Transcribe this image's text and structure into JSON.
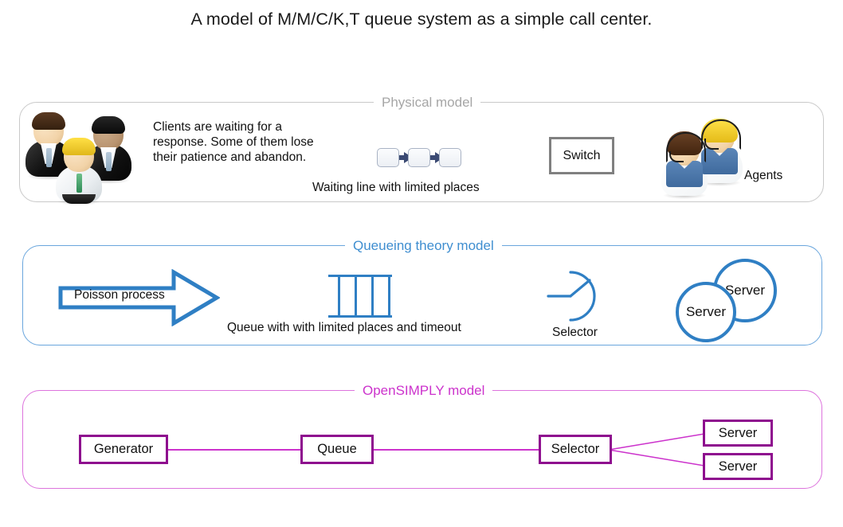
{
  "title": "A model of M/M/C/K,T queue system as a simple call center.",
  "colors": {
    "physical_border": "#c9c9c9",
    "physical_legend": "#a6a6a6",
    "queueing_border": "#6aa6dd",
    "queueing_legend": "#3f8ed0",
    "queueing_accent": "#2f7fc4",
    "opensimply_border": "#dd74dd",
    "opensimply_legend": "#cc33cc",
    "opensimply_box": "#8e0d8e",
    "switch_border": "#808080",
    "waiting_arrow": "#3b4a73"
  },
  "panels": {
    "physical": {
      "legend": "Physical model",
      "clients_text": "Clients are waiting for a response. Some of them lose their patience and abandon.",
      "waiting_caption": "Waiting line with limited places",
      "switch_label": "Switch",
      "agents_label": "Agents",
      "waiting_boxes": [
        "place-1",
        "place-2",
        "place-3"
      ],
      "client_avatars": [
        "client-dark-haired",
        "client-blond",
        "client-dark-skinned"
      ],
      "agent_avatars": [
        "agent-brunette",
        "agent-blonde"
      ]
    },
    "queueing": {
      "legend": "Queueing theory model",
      "poisson_label": "Poisson process",
      "queue_caption": "Queue with with limited places and timeout",
      "selector_label": "Selector",
      "servers": [
        "Server",
        "Server"
      ]
    },
    "opensimply": {
      "legend": "OpenSIMPLY model",
      "nodes": [
        {
          "label": "Generator"
        },
        {
          "label": "Queue"
        },
        {
          "label": "Selector"
        },
        {
          "label": "Server"
        },
        {
          "label": "Server"
        }
      ]
    }
  }
}
